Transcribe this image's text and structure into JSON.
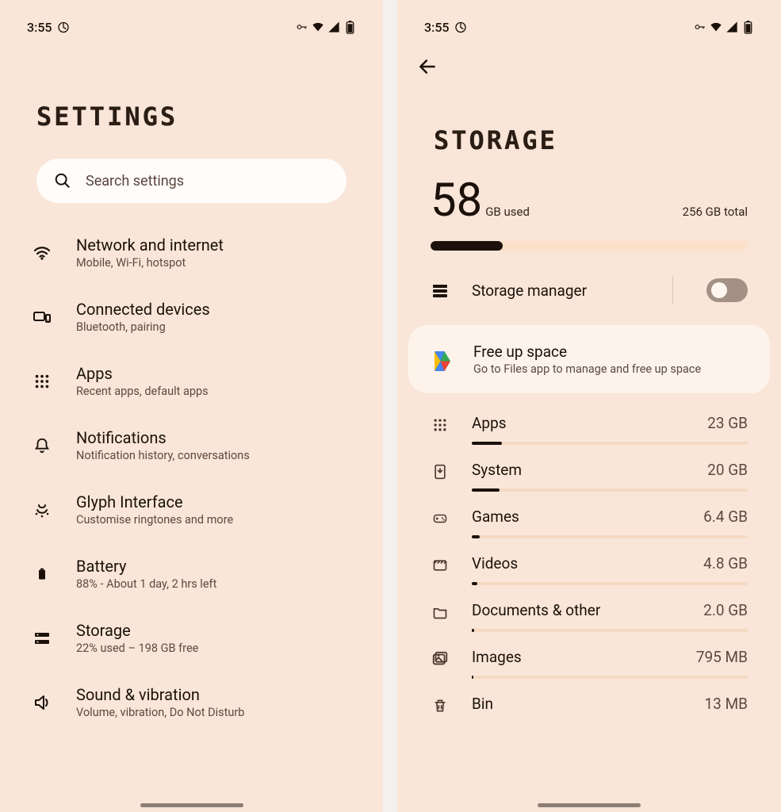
{
  "statusbar": {
    "time": "3:55"
  },
  "settings": {
    "title": "SETTINGS",
    "search_placeholder": "Search settings",
    "items": [
      {
        "label": "Network and internet",
        "sub": "Mobile, Wi-Fi, hotspot"
      },
      {
        "label": "Connected devices",
        "sub": "Bluetooth, pairing"
      },
      {
        "label": "Apps",
        "sub": "Recent apps, default apps"
      },
      {
        "label": "Notifications",
        "sub": "Notification history, conversations"
      },
      {
        "label": "Glyph Interface",
        "sub": "Customise ringtones and more"
      },
      {
        "label": "Battery",
        "sub": "88% - About 1 day, 2 hrs left"
      },
      {
        "label": "Storage",
        "sub": "22% used – 198 GB free"
      },
      {
        "label": "Sound & vibration",
        "sub": "Volume, vibration, Do Not Disturb"
      }
    ]
  },
  "storage": {
    "title": "STORAGE",
    "used_value": "58",
    "used_unit": "GB used",
    "total": "256 GB total",
    "progress_pct": 22.7,
    "manager_label": "Storage manager",
    "manager_on": false,
    "freeup": {
      "label": "Free up space",
      "sub": "Go to Files app to manage and free up space"
    },
    "categories": [
      {
        "label": "Apps",
        "size": "23 GB",
        "pct": 11
      },
      {
        "label": "System",
        "size": "20 GB",
        "pct": 10
      },
      {
        "label": "Games",
        "size": "6.4 GB",
        "pct": 3
      },
      {
        "label": "Videos",
        "size": "4.8 GB",
        "pct": 2
      },
      {
        "label": "Documents & other",
        "size": "2.0 GB",
        "pct": 1
      },
      {
        "label": "Images",
        "size": "795 MB",
        "pct": 0.4
      },
      {
        "label": "Bin",
        "size": "13 MB",
        "pct": 0
      }
    ]
  }
}
